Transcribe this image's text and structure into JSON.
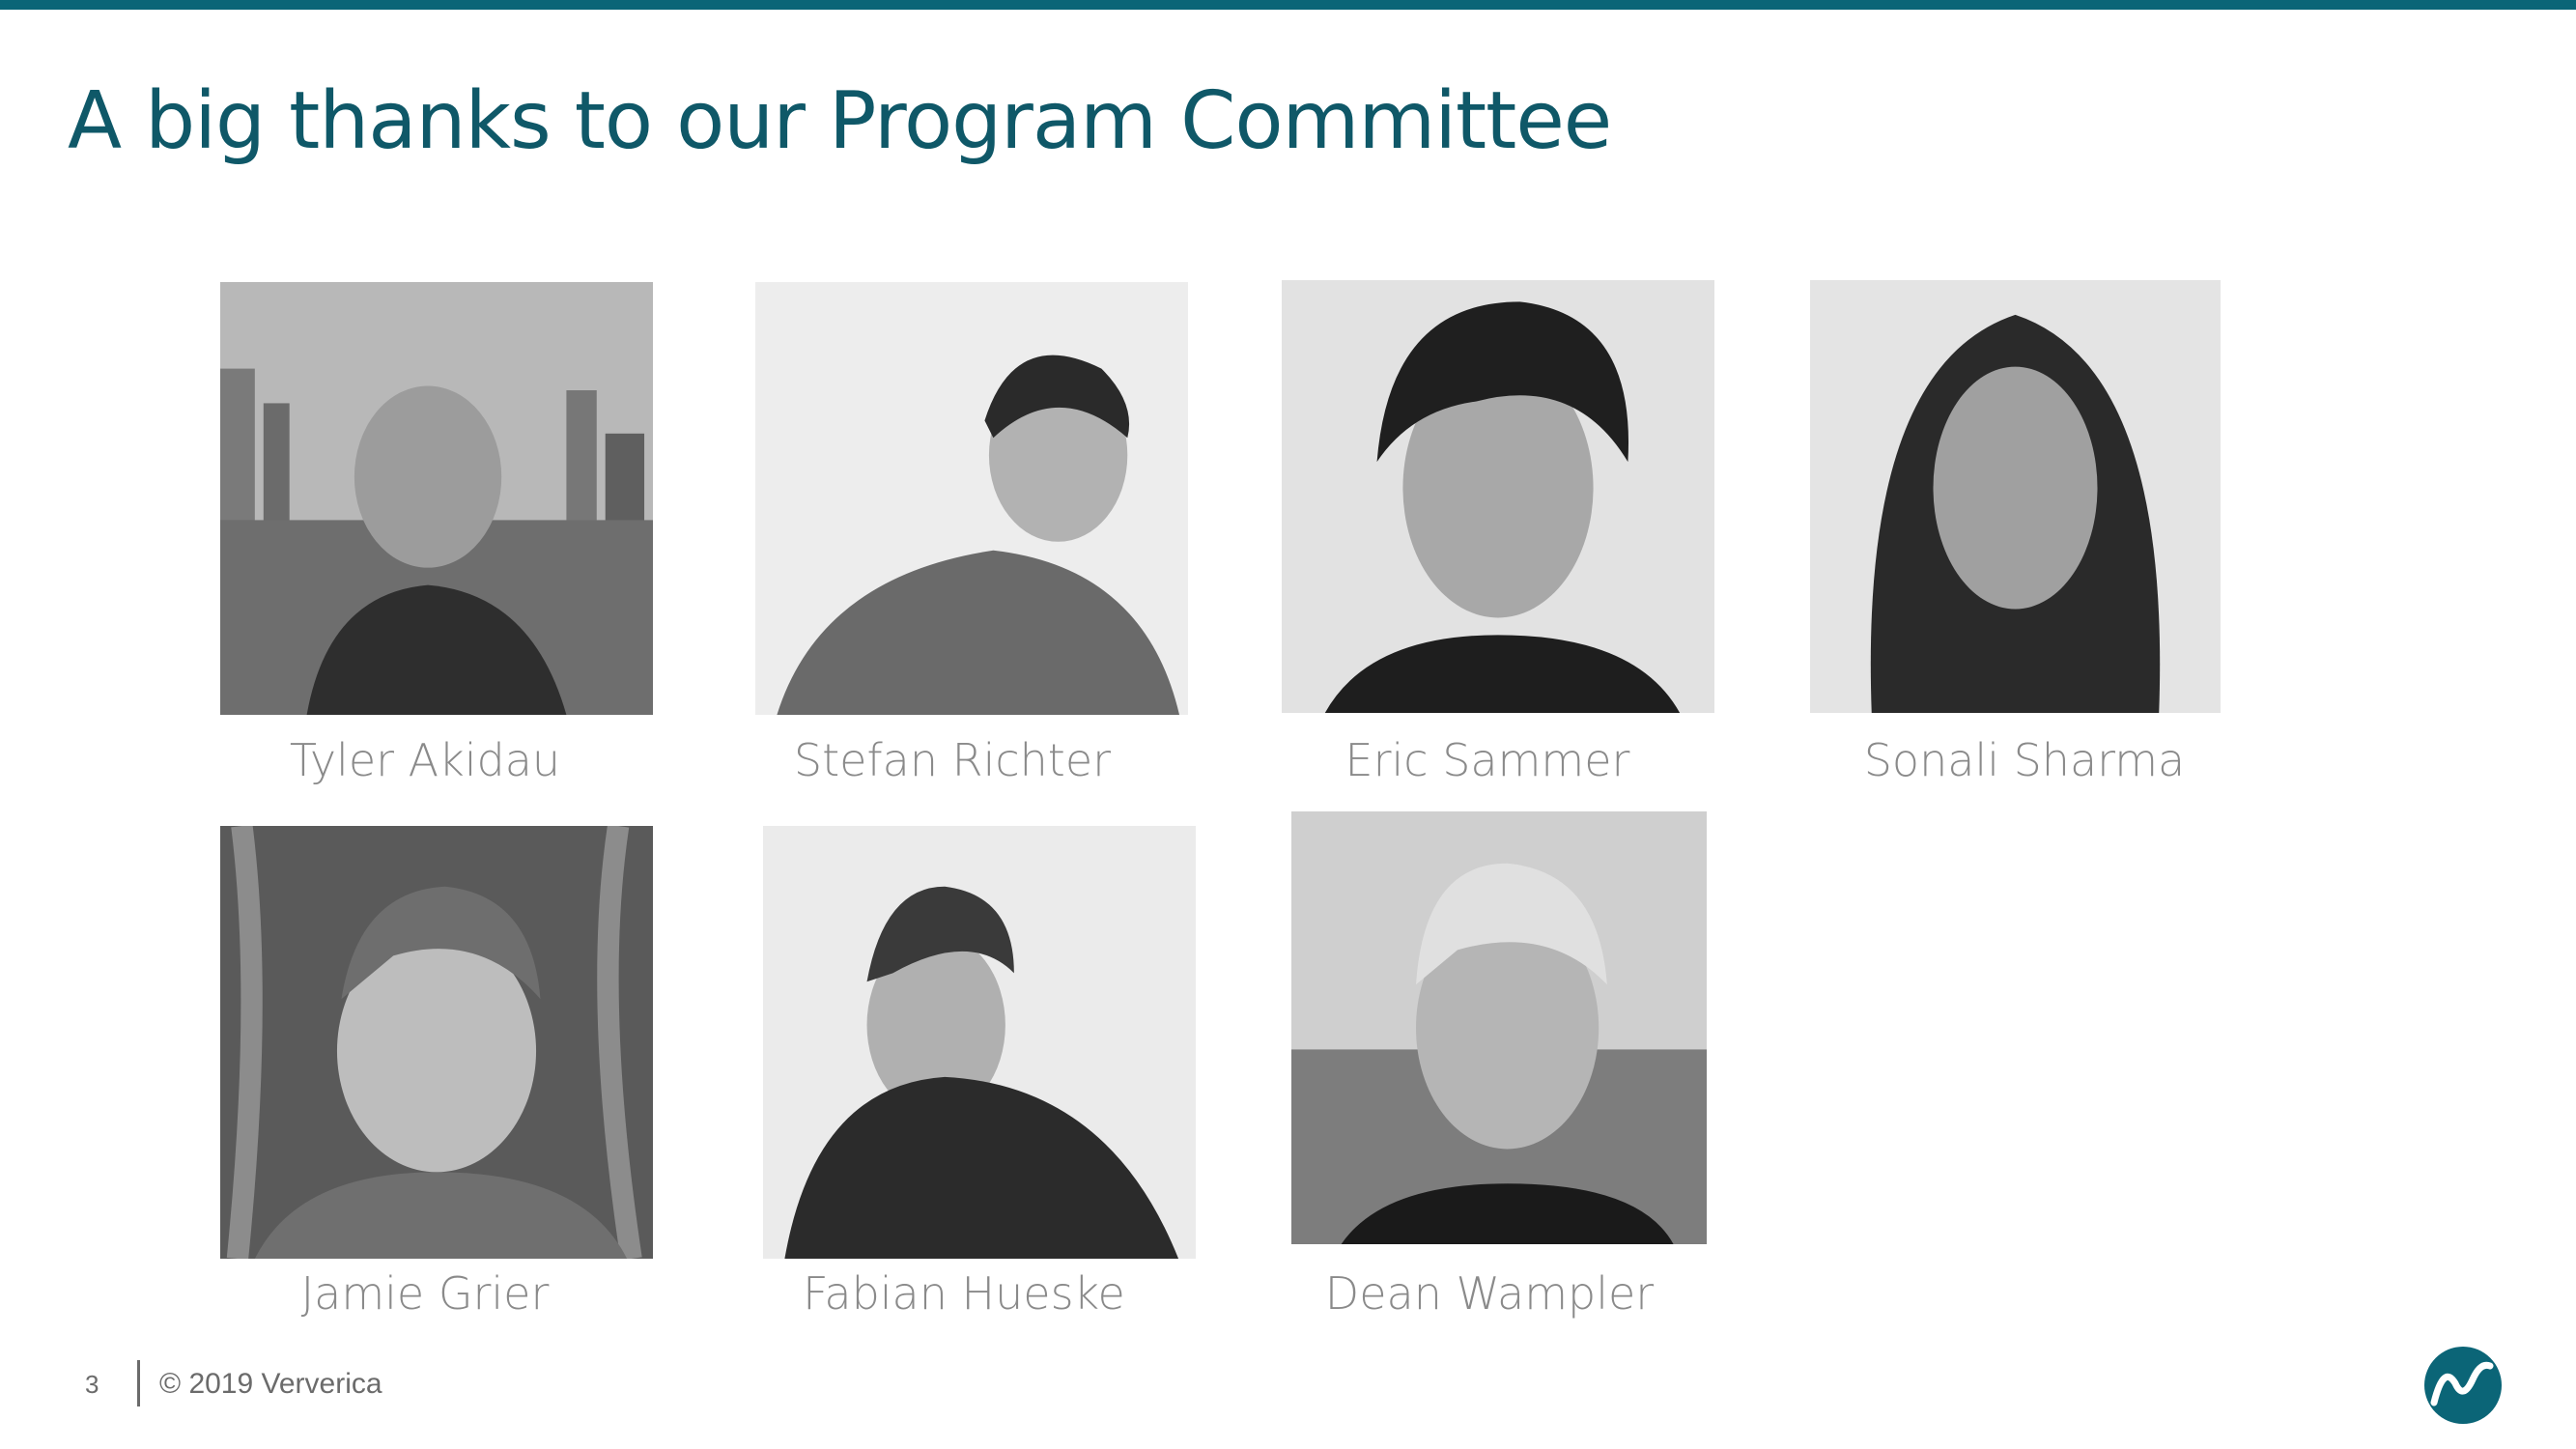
{
  "slide": {
    "title": "A big thanks to our Program Committee",
    "page_number": "3",
    "copyright": "© 2019 Ververica",
    "accent_color": "#0b6577"
  },
  "committee": [
    {
      "name": "Tyler Akidau"
    },
    {
      "name": "Stefan Richter"
    },
    {
      "name": "Eric Sammer"
    },
    {
      "name": "Sonali Sharma"
    },
    {
      "name": "Jamie Grier"
    },
    {
      "name": "Fabian Hueske"
    },
    {
      "name": "Dean Wampler"
    }
  ],
  "icons": {
    "logo": "ververica-logo-icon"
  }
}
